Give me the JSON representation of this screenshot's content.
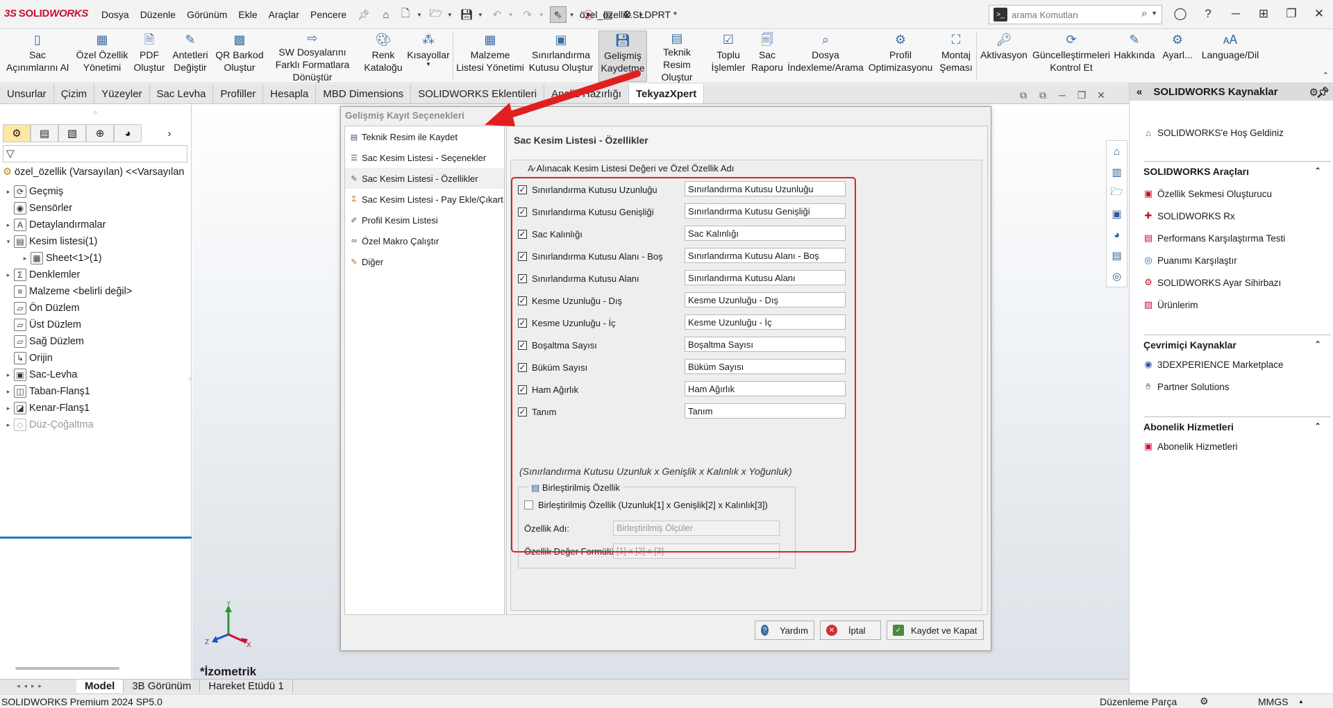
{
  "app": {
    "logo_ds": "3S",
    "logo_solid": "SOLID",
    "logo_works": "WORKS",
    "menu": [
      "Dosya",
      "Düzenle",
      "Görünüm",
      "Ekle",
      "Araçlar",
      "Pencere"
    ],
    "doc_title": "özel_özellik.SLDPRT *",
    "search_placeholder": "arama Komutları",
    "search_icon_text": ">_"
  },
  "ribbon": {
    "buttons": [
      {
        "label": "Sac Açınımlarını Al"
      },
      {
        "label": "Özel Özellik Yönetimi"
      },
      {
        "label": "PDF Oluştur"
      },
      {
        "label": "Antetleri Değiştir"
      },
      {
        "label": "QR Barkod Oluştur"
      },
      {
        "label": "SW Dosyalarını Farklı Formatlara Dönüştür"
      },
      {
        "label": "Renk Kataloğu"
      },
      {
        "label": "Kısayollar"
      },
      {
        "label": "Malzeme Listesi Yönetimi"
      },
      {
        "label": "Sınırlandırma Kutusu Oluştur"
      },
      {
        "label": "Gelişmiş Kaydetme"
      },
      {
        "label": "Teknik Resim Oluştur"
      },
      {
        "label": "Toplu İşlemler"
      },
      {
        "label": "Sac Raporu"
      },
      {
        "label": "Dosya İndexleme/Arama"
      },
      {
        "label": "Profil Optimizasyonu"
      },
      {
        "label": "Montaj Şeması"
      },
      {
        "label": "Aktivasyon"
      },
      {
        "label": "Güncelleştirmeleri Kontrol Et"
      },
      {
        "label": "Hakkında"
      },
      {
        "label": "Ayarl..."
      },
      {
        "label": "Language/Dil"
      }
    ]
  },
  "tabs": [
    "Unsurlar",
    "Çizim",
    "Yüzeyler",
    "Sac Levha",
    "Profiller",
    "Hesapla",
    "MBD Dimensions",
    "SOLIDWORKS Eklentileri",
    "Analiz Hazırlığı",
    "TekyazXpert"
  ],
  "feature_tree": {
    "root": "özel_özellik (Varsayılan) <<Varsayılan",
    "items": [
      {
        "label": "Geçmiş",
        "icon": "⟳"
      },
      {
        "label": "Sensörler",
        "icon": "◉"
      },
      {
        "label": "Detaylandırmalar",
        "icon": "A"
      },
      {
        "label": "Kesim listesi(1)",
        "icon": "▤"
      },
      {
        "label": "Sheet<1>(1)",
        "icon": "▦"
      },
      {
        "label": "Denklemler",
        "icon": "Σ"
      },
      {
        "label": "Malzeme <belirli değil>",
        "icon": "≡"
      },
      {
        "label": "Ön Düzlem",
        "icon": "▱"
      },
      {
        "label": "Üst Düzlem",
        "icon": "▱"
      },
      {
        "label": "Sağ Düzlem",
        "icon": "▱"
      },
      {
        "label": "Orijin",
        "icon": "↳"
      },
      {
        "label": "Sac-Levha",
        "icon": "▣"
      },
      {
        "label": "Taban-Flanş1",
        "icon": "◫"
      },
      {
        "label": "Kenar-Flanş1",
        "icon": "◪"
      },
      {
        "label": "Düz-Çoğaltma",
        "icon": "◇"
      }
    ]
  },
  "viewport": {
    "view_label": "*İzometrik"
  },
  "dialog": {
    "title": "Gelişmiş Kayıt Seçenekleri",
    "nav": [
      {
        "label": "Teknik Resim ile Kaydet"
      },
      {
        "label": "Sac Kesim Listesi - Seçenekler"
      },
      {
        "label": "Sac Kesim Listesi - Özellikler"
      },
      {
        "label": "Sac Kesim Listesi - Pay Ekle/Çıkart"
      },
      {
        "label": "Profil Kesim Listesi"
      },
      {
        "label": "Özel Makro Çalıştır"
      },
      {
        "label": "Diğer"
      }
    ],
    "main_title": "Sac Kesim Listesi - Özellikler",
    "group_title": "Alınacak Kesim Listesi Değeri ve Özel Özellik Adı",
    "properties": [
      {
        "label": "Sınırlandırma Kutusu Uzunluğu",
        "value": "Sınırlandırma Kutusu Uzunluğu",
        "checked": "✓"
      },
      {
        "label": "Sınırlandırma Kutusu Genişliği",
        "value": "Sınırlandırma Kutusu Genişliği",
        "checked": "✓"
      },
      {
        "label": "Sac Kalınlığı",
        "value": "Sac Kalınlığı",
        "checked": "✓"
      },
      {
        "label": "Sınırlandırma Kutusu Alanı - Boş",
        "value": "Sınırlandırma Kutusu Alanı - Boş",
        "checked": "✓"
      },
      {
        "label": "Sınırlandırma Kutusu Alanı",
        "value": "Sınırlandırma Kutusu Alanı",
        "checked": "✓"
      },
      {
        "label": "Kesme Uzunluğu - Dış",
        "value": "Kesme Uzunluğu - Dış",
        "checked": "✓"
      },
      {
        "label": "Kesme Uzunluğu - İç",
        "value": "Kesme Uzunluğu - İç",
        "checked": "✓"
      },
      {
        "label": "Boşaltma Sayısı",
        "value": "Boşaltma Sayısı",
        "checked": "✓"
      },
      {
        "label": "Büküm Sayısı",
        "value": "Büküm Sayısı",
        "checked": "✓"
      },
      {
        "label": "Ham Ağırlık",
        "value": "Ham Ağırlık",
        "checked": "✓"
      },
      {
        "label": "Tanım",
        "value": "Tanım",
        "checked": "✓"
      }
    ],
    "hint": "(Sınırlandırma Kutusu Uzunluk x Genişlik x Kalınlık x Yoğunluk)",
    "combined": {
      "title": "Birleştirilmiş Özellik",
      "checkbox_label": "Birleştirilmiş Özellik (Uzunluk[1] x Genişlik[2] x Kalınlık[3])",
      "name_label": "Özellik Adı:",
      "name_value": "Birleştirilmiş Ölçüler",
      "formula_label": "Özellik Değer Formülü:",
      "formula_value": "[1] x [2] x [3]"
    },
    "buttons": {
      "help": "Yardım",
      "cancel": "İptal",
      "save_close": "Kaydet ve Kapat"
    }
  },
  "resources": {
    "title": "SOLIDWORKS Kaynaklar",
    "welcome": "SOLIDWORKS'e Hoş Geldiniz",
    "tools_title": "SOLIDWORKS Araçları",
    "tools": [
      "Özellik Sekmesi Oluşturucu",
      "SOLIDWORKS Rx",
      "Performans Karşılaştırma Testi",
      "Puanımı Karşılaştır",
      "SOLIDWORKS Ayar Sihirbazı",
      "Ürünlerim"
    ],
    "online_title": "Çevrimiçi Kaynaklar",
    "online": [
      "3DEXPERIENCE Marketplace",
      "Partner Solutions"
    ],
    "sub_title": "Abonelik Hizmetleri",
    "sub": [
      "Abonelik Hizmetleri"
    ]
  },
  "bottom_tabs": [
    "Model",
    "3B Görünüm",
    "Hareket Etüdü 1"
  ],
  "status": {
    "left": "SOLIDWORKS Premium 2024 SP5.0",
    "mode": "Düzenleme Parça",
    "units": "MMGS"
  },
  "colors": {
    "brand": "#c8102e",
    "highlight": "#e02020",
    "tree_blue": "#1c78c8"
  }
}
